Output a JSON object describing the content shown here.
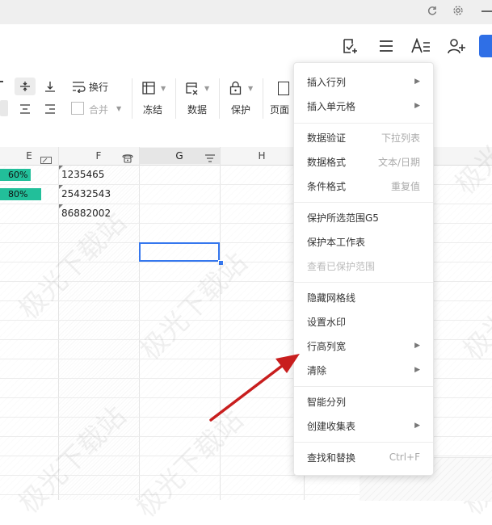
{
  "ribbon": {
    "wrap_text": "换行",
    "merge": "合并",
    "freeze": "冻结",
    "data": "数据",
    "protect": "保护",
    "page_setup": "页面"
  },
  "sheet": {
    "columns": [
      "E",
      "F",
      "G",
      "H"
    ],
    "progress": [
      {
        "label": "60%",
        "value": 60
      },
      {
        "label": "80%",
        "value": 80
      }
    ],
    "f_values": [
      "1235465",
      "25432543",
      "86882002"
    ]
  },
  "menu": {
    "items": [
      {
        "label": "插入行列",
        "submenu": true
      },
      {
        "label": "插入单元格",
        "submenu": true
      },
      {
        "label": "数据验证",
        "hint": "下拉列表"
      },
      {
        "label": "数据格式",
        "hint": "文本/日期"
      },
      {
        "label": "条件格式",
        "hint": "重复值"
      },
      {
        "label": "保护所选范围G5"
      },
      {
        "label": "保护本工作表"
      },
      {
        "label": "查看已保护范围",
        "disabled": true
      },
      {
        "label": "隐藏网格线"
      },
      {
        "label": "设置水印"
      },
      {
        "label": "行高列宽",
        "submenu": true
      },
      {
        "label": "清除",
        "submenu": true
      },
      {
        "label": "智能分列"
      },
      {
        "label": "创建收集表",
        "submenu": true
      },
      {
        "label": "查找和替换",
        "hint": "Ctrl+F"
      }
    ]
  },
  "watermark": "极光下载站",
  "colors": {
    "accent": "#2f6fe6",
    "progress_bar": "#22bf9a",
    "selection": "#3577ee",
    "arrow": "#c81e1e"
  },
  "icons": {
    "sync": "sync-icon",
    "settings": "gear-icon",
    "add_comment": "add-comment-icon",
    "menu": "hamburger-icon",
    "text_style": "text-style-icon",
    "add_user": "add-user-icon"
  }
}
